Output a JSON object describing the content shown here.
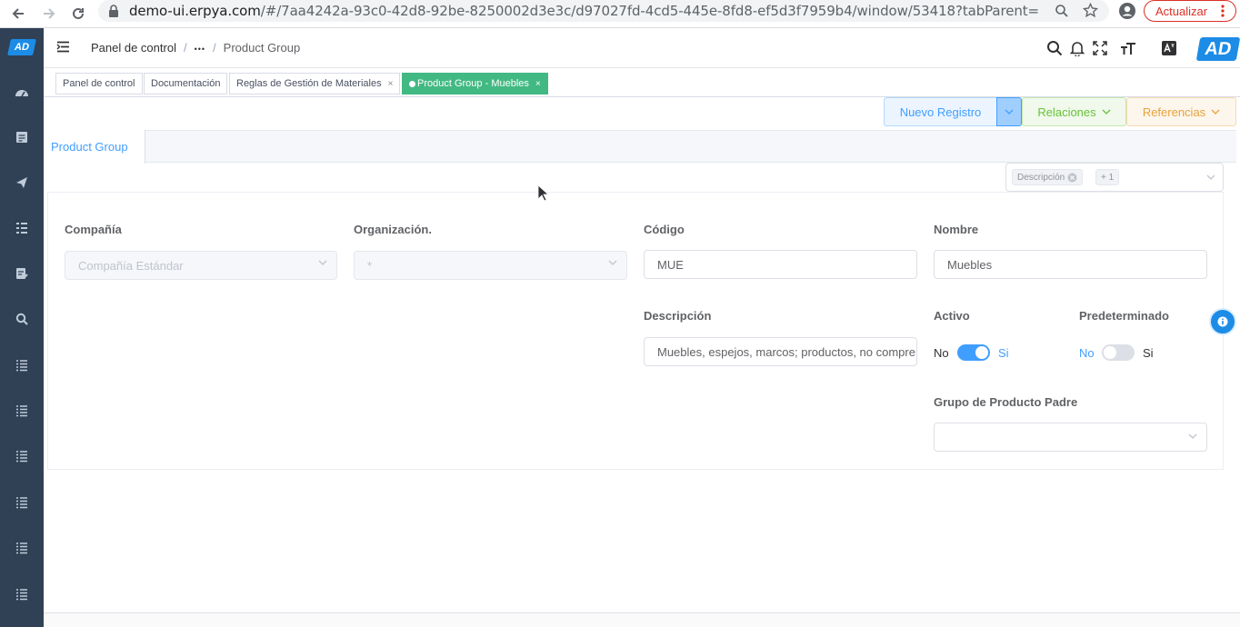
{
  "browser": {
    "url_host": "demo-ui.erpya.com",
    "url_path": "/#/7aa4242a-93c0-42d8-92be-8250002d3e3c/d97027fd-4cd5-445e-8fd8-ef5d3f7959b4/window/53418?tabParent=0&action=a4610...",
    "update_label": "Actualizar"
  },
  "sidebar": {
    "logo": "AD",
    "items": [
      "dashboard-icon",
      "document-icon",
      "send-icon",
      "list-icon",
      "form-icon",
      "search-icon",
      "list-icon",
      "list-icon",
      "list-icon",
      "list-icon",
      "list-icon",
      "list-icon"
    ]
  },
  "header": {
    "breadcrumb": [
      "Panel de control",
      "•••",
      "Product Group"
    ],
    "avatar": "AD"
  },
  "tags": [
    {
      "label": "Panel de control",
      "closable": false
    },
    {
      "label": "Documentación",
      "closable": false
    },
    {
      "label": "Reglas de Gestión de Materiales",
      "closable": true
    },
    {
      "label": "Product Group - Muebles",
      "closable": true,
      "active": true
    }
  ],
  "actions": {
    "new_record": "Nuevo Registro",
    "relations": "Relaciones",
    "references": "Referencias"
  },
  "tab": {
    "label": "Product Group"
  },
  "column_selector": {
    "chips": [
      "Descripción",
      "+ 1"
    ]
  },
  "form": {
    "company": {
      "label": "Compañía",
      "value": "Compañía Estándar"
    },
    "organization": {
      "label": "Organización.",
      "value": "*"
    },
    "code": {
      "label": "Código",
      "value": "MUE"
    },
    "name": {
      "label": "Nombre",
      "value": "Muebles"
    },
    "description": {
      "label": "Descripción",
      "value": "Muebles, espejos, marcos; productos, no compre"
    },
    "active": {
      "label": "Activo",
      "off": "No",
      "on": "Si",
      "value": true
    },
    "default": {
      "label": "Predeterminado",
      "off": "No",
      "on": "Si",
      "value": false
    },
    "parent_group": {
      "label": "Grupo de Producto Padre",
      "value": ""
    }
  },
  "colors": {
    "sidebar_bg": "#304156",
    "accent": "#409eff",
    "active_tag": "#42b983"
  }
}
